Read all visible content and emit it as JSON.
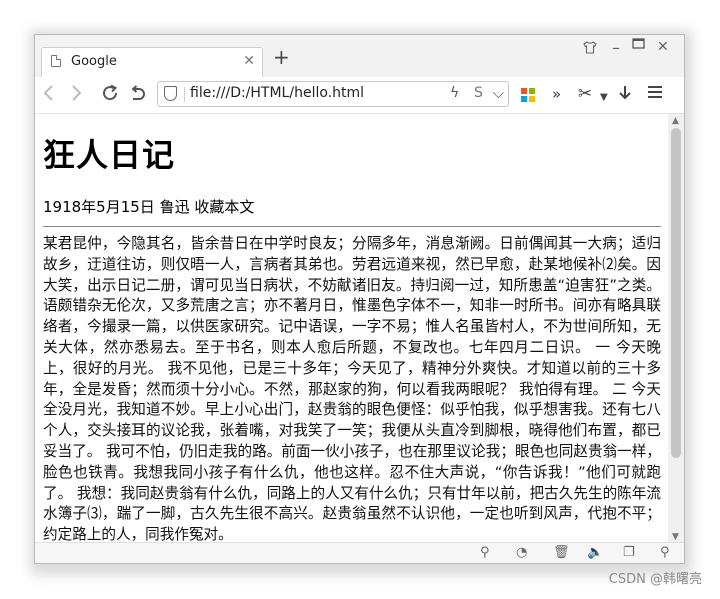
{
  "tab": {
    "title": "Google"
  },
  "address_bar": {
    "url": "file:///D:/HTML/hello.html"
  },
  "apps_colors": [
    "#f25022",
    "#7fba00",
    "#00a4ef",
    "#ffb900"
  ],
  "article": {
    "title": "狂人日记",
    "meta": "1918年5月15日 鲁迅 收藏本文",
    "body": "某君昆仲，今隐其名，皆余昔日在中学时良友；分隔多年，消息渐阙。日前偶闻其一大病；适归故乡，迂道往访，则仅晤一人，言病者其弟也。劳君远道来视，然已早愈，赴某地候补⑵矣。因大笑，出示日记二册，谓可见当日病状，不妨献诸旧友。持归阅一过，知所患盖“迫害狂”之类。语颇错杂无伦次，又多荒唐之言；亦不著月日，惟墨色字体不一，知非一时所书。间亦有略具联络者，今撮录一篇，以供医家研究。记中语误，一字不易；惟人名虽皆村人，不为世间所知，无关大体，然亦悉易去。至于书名，则本人愈后所题，不复改也。七年四月二日识。 一 今天晚上，很好的月光。 我不见他，已是三十多年；今天见了，精神分外爽快。才知道以前的三十多年，全是发昏；然而须十分小心。不然，那赵家的狗，何以看我两眼呢？ 我怕得有理。 二 今天全没月光，我知道不妙。早上小心出门，赵贵翁的眼色便怪：似乎怕我，似乎想害我。还有七八个人，交头接耳的议论我，张着嘴，对我笑了一笑；我便从头直冷到脚根，晓得他们布置，都已妥当了。 我可不怕，仍旧走我的路。前面一伙小孩子，也在那里议论我；眼色也同赵贵翁一样，脸色也铁青。我想我同小孩子有什么仇，他也这样。忍不住大声说，“你告诉我！”他们可就跑了。 我想：我同赵贵翁有什么仇，同路上的人又有什么仇；只有廿年以前，把古久先生的陈年流水簿子⑶，踹了一脚，古久先生很不高兴。赵贵翁虽然不认识他，一定也听到风声，代抱不平；约定路上的人，同我作冤对。"
  },
  "watermark": "CSDN @韩曙亮"
}
